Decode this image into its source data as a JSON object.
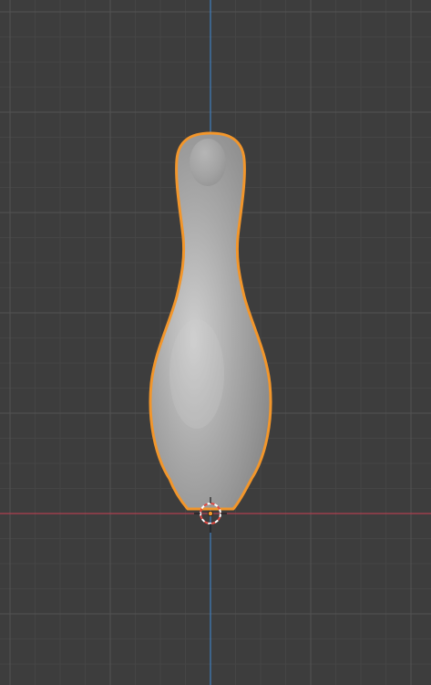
{
  "viewport": {
    "view": "front-orthographic",
    "background_color": "#3d3d3d",
    "grid_minor_color": "#454545",
    "grid_major_color": "#525252",
    "x_axis_color": "#b0404f",
    "z_axis_color": "#3f7fbf"
  },
  "object": {
    "shape": "bowling-pin",
    "selected": true,
    "outline_color": "#f2962b",
    "fill_color": "#a3a3a3",
    "highlight_color": "#c9c9c9",
    "shadow_color": "#6e6e6e"
  },
  "cursor_3d": {
    "icon": "3d-cursor-icon",
    "ring_red": "#e14a43",
    "ring_white": "#ffffff"
  },
  "origin": {
    "icon": "origin-dot-icon",
    "color": "#f2962b"
  }
}
